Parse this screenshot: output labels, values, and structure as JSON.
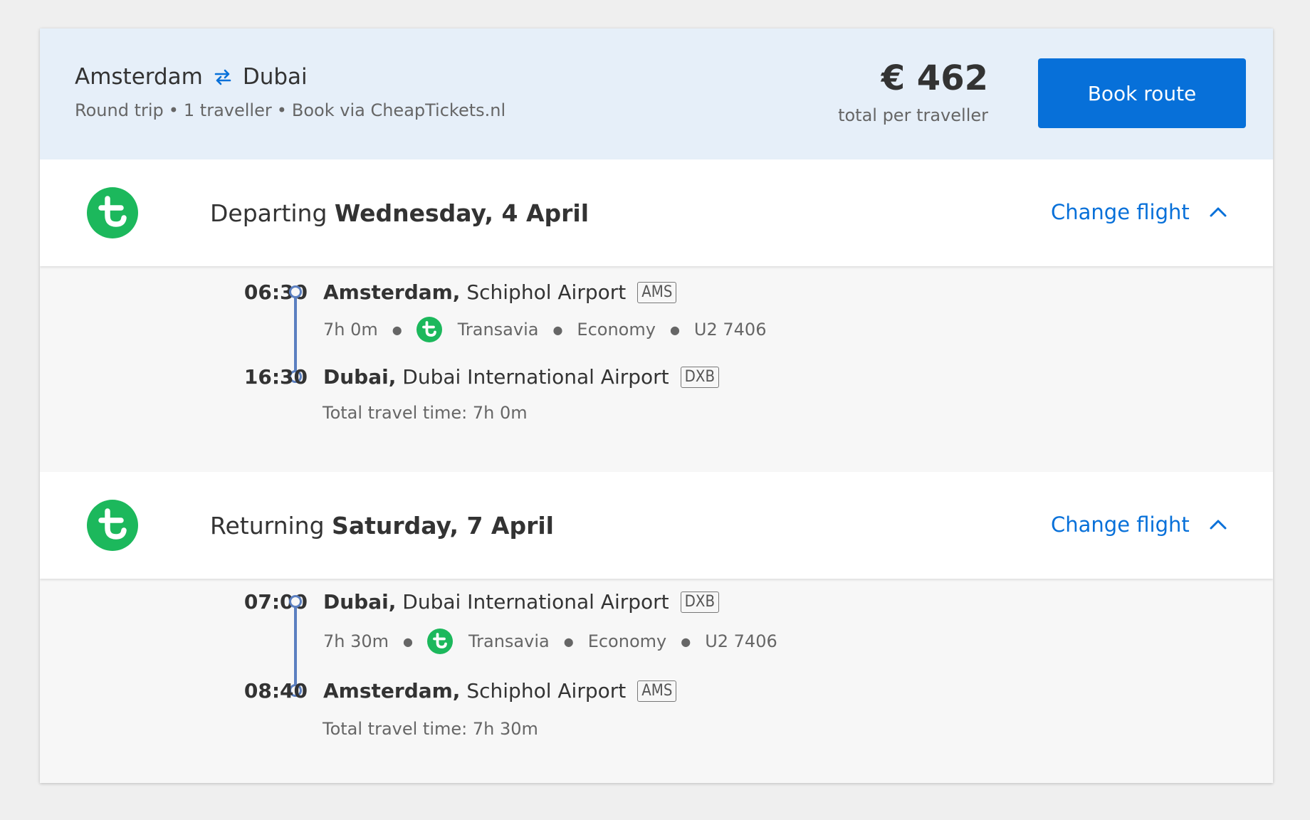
{
  "summary": {
    "origin": "Amsterdam",
    "destination": "Dubai",
    "trip_type": "Round trip",
    "travellers": "1 traveller",
    "booking": "Book via CheapTickets.nl",
    "price": "€ 462",
    "price_note": "total per traveller",
    "book_label": "Book route"
  },
  "colors": {
    "accent": "#0770d9",
    "header_bg": "#e6eff9",
    "airline_green": "#1cb85c",
    "timeline": "#5b7fc0"
  },
  "legs": [
    {
      "direction": "Departing",
      "date": "Wednesday, 4 April",
      "change_label": "Change flight",
      "airline_icon": "transavia-logo-icon",
      "toggle_icon": "chevron-up-icon",
      "dep_time": "06:30",
      "dep_city": "Amsterdam,",
      "dep_airport": "Schiphol Airport",
      "dep_code": "AMS",
      "duration": "7h 0m",
      "airline": "Transavia",
      "cabin": "Economy",
      "flight_no": "U2 7406",
      "arr_time": "16:30",
      "arr_city": "Dubai,",
      "arr_airport": "Dubai International Airport",
      "arr_code": "DXB",
      "total": "Total travel time: 7h 0m"
    },
    {
      "direction": "Returning",
      "date": "Saturday, 7 April",
      "change_label": "Change flight",
      "airline_icon": "transavia-logo-icon",
      "toggle_icon": "chevron-up-icon",
      "dep_time": "07:00",
      "dep_city": "Dubai,",
      "dep_airport": "Dubai International Airport",
      "dep_code": "DXB",
      "duration": "7h 30m",
      "airline": "Transavia",
      "cabin": "Economy",
      "flight_no": "U2 7406",
      "arr_time": "08:40",
      "arr_city": "Amsterdam,",
      "arr_airport": "Schiphol Airport",
      "arr_code": "AMS",
      "total": "Total travel time: 7h 30m"
    }
  ]
}
